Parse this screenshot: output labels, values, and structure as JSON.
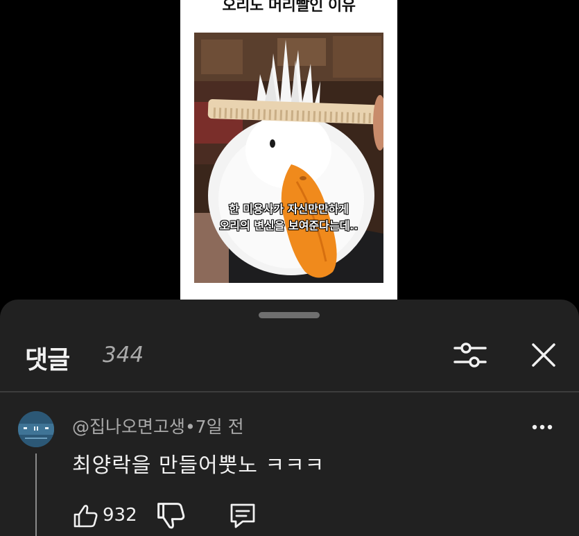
{
  "video": {
    "title": "오리도 머리빨인 이유",
    "caption_line1": "한 미용사가 자신만만하게",
    "caption_line2": "오리의 변신을 보여준다는데.."
  },
  "comments_panel": {
    "title": "댓글",
    "count": "344",
    "filter_icon": "sliders-icon",
    "close_icon": "close-icon"
  },
  "comment": {
    "author": "@집나오면고생",
    "separator": "•",
    "time": "7일 전",
    "text": "최양락을 만들어뿟노 ㅋㅋㅋ",
    "likes": "932",
    "icons": [
      "thumbs-up-icon",
      "thumbs-down-icon",
      "reply-icon",
      "more-icon"
    ]
  },
  "colors": {
    "background": "#000000",
    "sheet": "#212121",
    "primary_text": "#f1f1f1",
    "secondary_text": "#aaaaaa",
    "duck_bill": "#f08a1c"
  }
}
